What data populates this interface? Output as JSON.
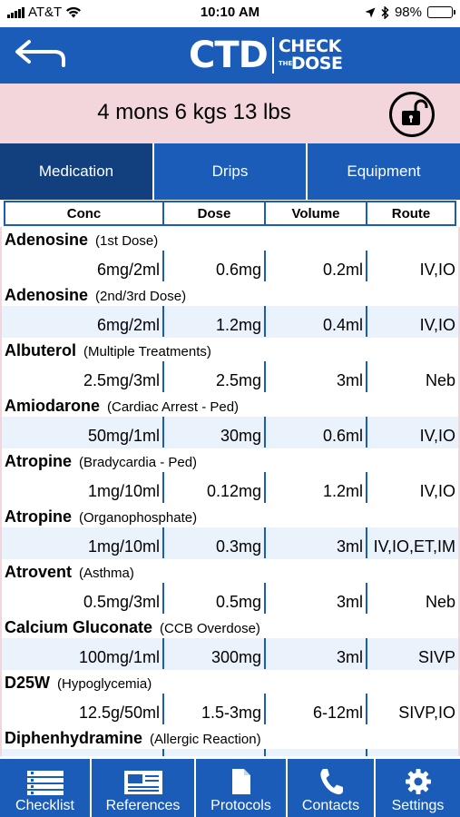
{
  "status_bar": {
    "carrier": "AT&T",
    "time": "10:10 AM",
    "battery": "98%",
    "battery_level": 0.98
  },
  "header": {
    "logo_main": "CTD",
    "logo_line1": "CHECK",
    "logo_line2": "THE",
    "logo_line3": "DOSE",
    "back_icon": "back-arrow-icon",
    "colors": {
      "primary": "#1a5cb8",
      "active_tab": "#12407f",
      "patient_band": "#f3d5dc",
      "alt_row": "#eaf2fc"
    }
  },
  "patient": {
    "summary": "4 mons 6 kgs 13 lbs",
    "lock_icon": "unlock-icon"
  },
  "tabs": [
    {
      "label": "Medication",
      "active": true
    },
    {
      "label": "Drips",
      "active": false
    },
    {
      "label": "Equipment",
      "active": false
    }
  ],
  "columns": [
    "Conc",
    "Dose",
    "Volume",
    "Route"
  ],
  "medications": [
    {
      "name": "Adenosine",
      "qualifier": "(1st Dose)",
      "conc": "6mg/2ml",
      "dose": "0.6mg",
      "volume": "0.2ml",
      "route": "IV,IO"
    },
    {
      "name": "Adenosine",
      "qualifier": "(2nd/3rd Dose)",
      "conc": "6mg/2ml",
      "dose": "1.2mg",
      "volume": "0.4ml",
      "route": "IV,IO"
    },
    {
      "name": "Albuterol",
      "qualifier": "(Multiple Treatments)",
      "conc": "2.5mg/3ml",
      "dose": "2.5mg",
      "volume": "3ml",
      "route": "Neb"
    },
    {
      "name": "Amiodarone",
      "qualifier": "(Cardiac Arrest - Ped)",
      "conc": "50mg/1ml",
      "dose": "30mg",
      "volume": "0.6ml",
      "route": "IV,IO"
    },
    {
      "name": "Atropine",
      "qualifier": "(Bradycardia - Ped)",
      "conc": "1mg/10ml",
      "dose": "0.12mg",
      "volume": "1.2ml",
      "route": "IV,IO"
    },
    {
      "name": "Atropine",
      "qualifier": "(Organophosphate)",
      "conc": "1mg/10ml",
      "dose": "0.3mg",
      "volume": "3ml",
      "route": "IV,IO,ET,IM"
    },
    {
      "name": "Atrovent",
      "qualifier": "(Asthma)",
      "conc": "0.5mg/3ml",
      "dose": "0.5mg",
      "volume": "3ml",
      "route": "Neb"
    },
    {
      "name": "Calcium Gluconate",
      "qualifier": "(CCB Overdose)",
      "conc": "100mg/1ml",
      "dose": "300mg",
      "volume": "3ml",
      "route": "SIVP"
    },
    {
      "name": "D25W",
      "qualifier": "(Hypoglycemia)",
      "conc": "12.5g/50ml",
      "dose": "1.5-3mg",
      "volume": "6-12ml",
      "route": "SIVP,IO"
    },
    {
      "name": "Diphenhydramine",
      "qualifier": "(Allergic Reaction)",
      "conc": "",
      "dose": "",
      "volume": "",
      "route": ""
    }
  ],
  "bottom_nav": [
    {
      "label": "Checklist",
      "icon": "checklist-icon"
    },
    {
      "label": "References",
      "icon": "references-icon"
    },
    {
      "label": "Protocols",
      "icon": "document-icon"
    },
    {
      "label": "Contacts",
      "icon": "phone-icon"
    },
    {
      "label": "Settings",
      "icon": "gear-icon"
    }
  ]
}
